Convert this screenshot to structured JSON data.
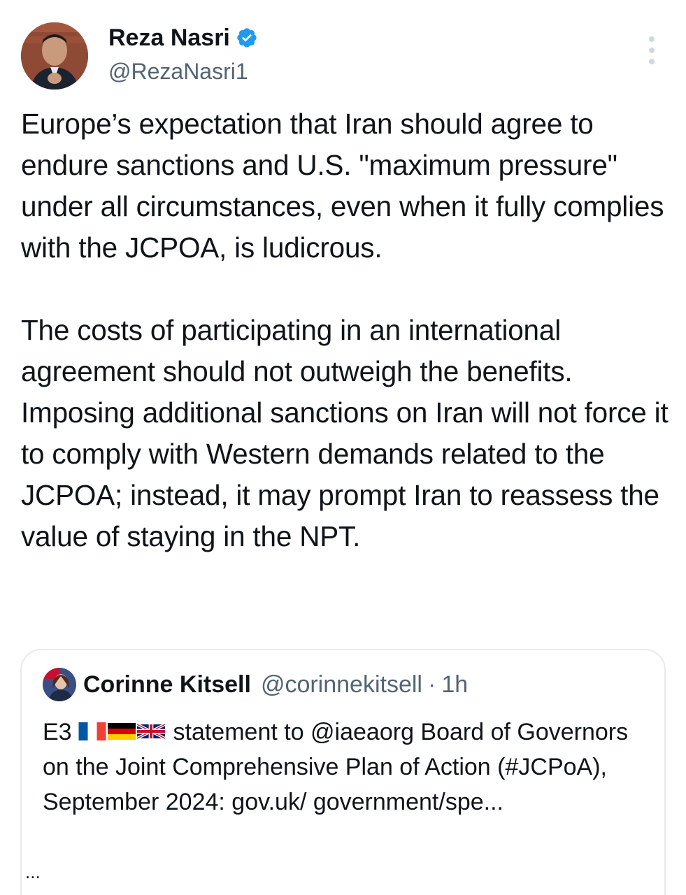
{
  "author": {
    "name": "Reza Nasri",
    "handle": "@RezaNasri1"
  },
  "tweet": {
    "paragraph1": "Europe’s expectation that Iran should agree to endure sanctions and U.S. \"maximum pressure\" under all circumstances, even when it fully complies with the JCPOA, is ludicrous.",
    "paragraph2": "The costs of participating in an international agreement should not outweigh the benefits. Imposing additional sanctions on Iran will not force it to comply with Western demands related to the JCPOA; instead, it may prompt Iran to reassess the value of staying in the NPT."
  },
  "quote": {
    "name": "Corinne Kitsell",
    "handle": "@corinnekitsell",
    "separator": "·",
    "time": "1h",
    "text_prefix": "E3",
    "text_main": "statement to @iaeaorg Board of Governors on the Joint Comprehensive Plan of Action (#JCPoA), September 2024: gov.uk/ government/spe...",
    "ellipsis": "..."
  },
  "colors": {
    "verified": "#1d9bf0",
    "secondary_text": "#536471",
    "border": "#e6ebee"
  }
}
